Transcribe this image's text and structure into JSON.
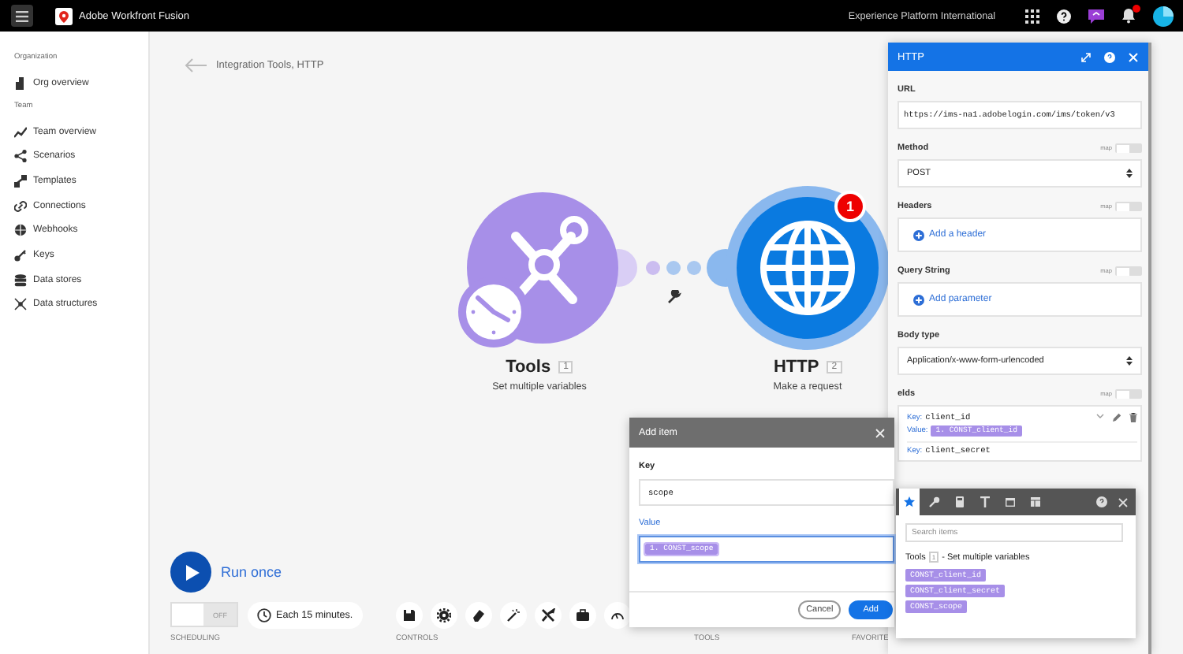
{
  "topbar": {
    "app_name": "Adobe Workfront Fusion",
    "org": "Experience Platform International"
  },
  "sidebar": {
    "sections": [
      {
        "title": "Organization",
        "items": [
          {
            "label": "Org overview"
          }
        ]
      },
      {
        "title": "Team",
        "items": [
          {
            "label": "Team overview"
          },
          {
            "label": "Scenarios"
          },
          {
            "label": "Templates"
          },
          {
            "label": "Connections"
          },
          {
            "label": "Webhooks"
          },
          {
            "label": "Keys"
          },
          {
            "label": "Data stores"
          },
          {
            "label": "Data structures"
          }
        ]
      }
    ]
  },
  "breadcrumb": "Integration Tools, HTTP",
  "nodes": [
    {
      "kind": "tools",
      "name": "Tools",
      "number": "1",
      "subtitle": "Set multiple variables"
    },
    {
      "kind": "http",
      "name": "HTTP",
      "number": "2",
      "subtitle": "Make a request",
      "badge": "1"
    }
  ],
  "run": {
    "label": "Run once"
  },
  "scheduling": {
    "label": "SCHEDULING",
    "toggle": {
      "text": "OFF",
      "on": false
    },
    "interval": "Each 15 minutes."
  },
  "controls": {
    "label": "CONTROLS"
  },
  "tools_label": "TOOLS",
  "favorites_label": "FAVORITE",
  "http_panel": {
    "title": "HTTP",
    "fields": [
      {
        "kind": "input",
        "label": "URL",
        "value": "https://ims-na1.adobelogin.com/ims/token/v3"
      },
      {
        "kind": "select",
        "label": "Method",
        "map_label": "map",
        "map_on": false,
        "value": "POST"
      },
      {
        "kind": "add",
        "label": "Headers",
        "map_label": "map",
        "map_on": false,
        "action": "Add a header"
      },
      {
        "kind": "add",
        "label": "Query String",
        "map_label": "map",
        "map_on": false,
        "action": "Add parameter"
      },
      {
        "kind": "select",
        "label": "Body type",
        "value": "Application/x-www-form-urlencoded"
      },
      {
        "kind": "items",
        "label": "elds",
        "map_label": "map",
        "map_on": false,
        "items": [
          {
            "key_label": "Key:",
            "key": "client_id",
            "value_label": "Value:",
            "value": "1. CONST_client_id"
          },
          {
            "key_label": "Key:",
            "key": "client_secret"
          }
        ]
      }
    ]
  },
  "add_item_dialog": {
    "title": "Add item",
    "key_label": "Key",
    "key": "scope",
    "value_label": "Value",
    "value": "1. CONST_scope",
    "buttons": [
      {
        "kind": "secondary",
        "label": "Cancel"
      },
      {
        "kind": "primary",
        "label": "Add"
      }
    ]
  },
  "mapping_popup": {
    "tabs": [
      {
        "selected": true
      },
      {
        "selected": false
      },
      {
        "selected": false
      },
      {
        "selected": false
      },
      {
        "selected": false
      },
      {
        "selected": false
      }
    ],
    "search_placeholder": "Search items",
    "module": {
      "name": "Tools",
      "number": "1",
      "description": "- Set multiple variables"
    },
    "variables": [
      "CONST_client_id",
      "CONST_client_secret",
      "CONST_scope"
    ]
  }
}
